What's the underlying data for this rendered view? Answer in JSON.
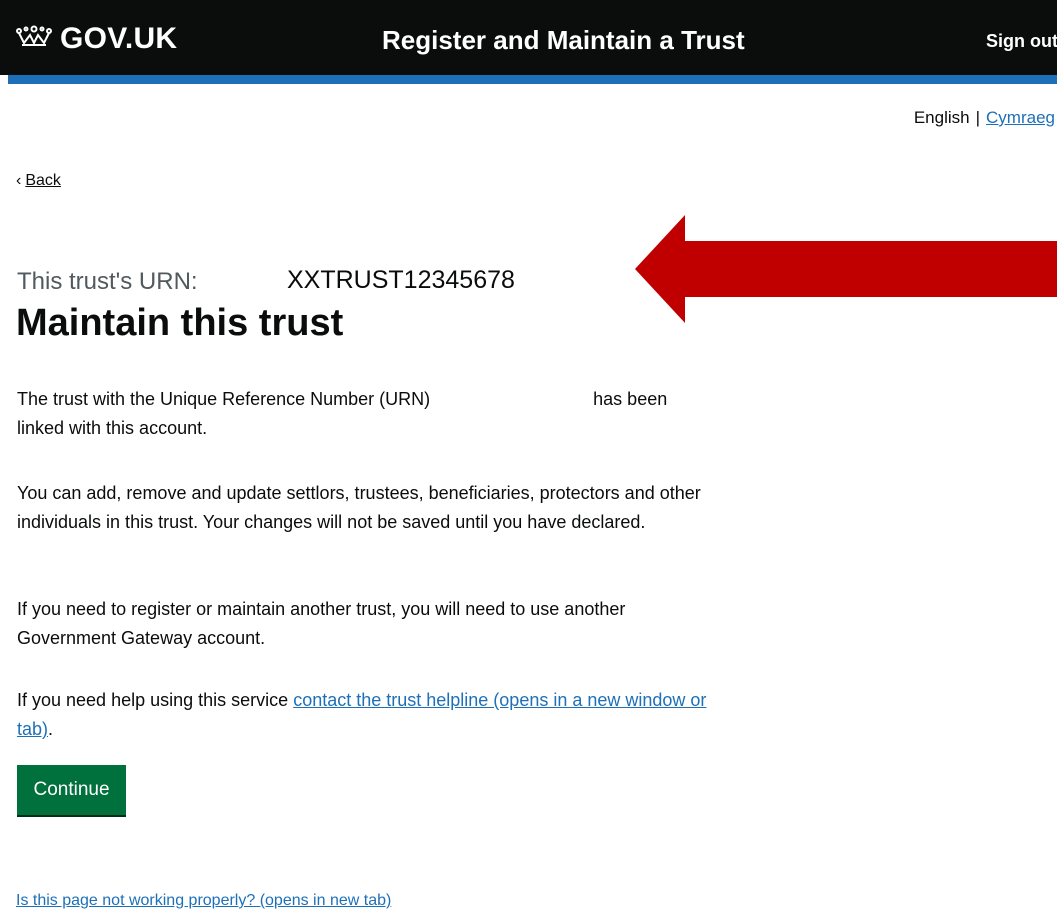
{
  "header": {
    "logo_text": "GOV.UK",
    "logo_icon": "crown-icon",
    "service_name": "Register and Maintain a Trust",
    "sign_out_label": "Sign out",
    "background_color": "#0b0c0c",
    "accent_color": "#1d70b8"
  },
  "language": {
    "english_label": "English",
    "separator": "|",
    "welsh_label": "Cymraeg"
  },
  "back_link": {
    "icon": "chevron-left-icon",
    "label": "Back"
  },
  "main": {
    "caption": "This trust's URN:",
    "urn_value": "XXTRUST12345678",
    "title": "Maintain this trust",
    "paragraph_1_start": "The trust with the Unique Reference Number (URN)",
    "paragraph_1_end": "has been linked with this account.",
    "paragraph_2": "You can add, remove and update settlors, trustees, beneficiaries, protectors and other individuals in this trust. Your changes will not be saved until you have declared.",
    "paragraph_3": "If you need to register or maintain another trust, you will need to use another Government Gateway account.",
    "paragraph_4_text": "If you need help using this service",
    "paragraph_4_link": "contact the trust helpline (opens in a new window or tab)",
    "paragraph_4_end": "."
  },
  "continue_button": {
    "label": "Continue",
    "color": "#00703c"
  },
  "footer_link": "Is this page not working properly? (opens in new tab)",
  "annotation": {
    "icon": "arrow-left-icon",
    "color": "#c00000"
  }
}
